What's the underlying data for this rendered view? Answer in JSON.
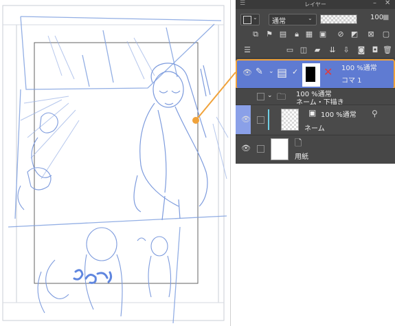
{
  "panel": {
    "title": "レイヤー",
    "blend_mode": "通常",
    "opacity": "100",
    "layers": [
      {
        "opacity_mode": "100 %通常",
        "name": "コマ 1",
        "selected": true
      },
      {
        "opacity_mode": "100 %通常",
        "name": "ネーム・下描き",
        "type": "folder"
      },
      {
        "opacity_mode": "100 %通常",
        "name": "ネーム"
      },
      {
        "name": "用紙"
      }
    ]
  },
  "colors": {
    "panel_bg": "#474747",
    "selected_layer": "#5f7bd2",
    "highlight": "#f0a23a",
    "sketch_blue": "#7fa0e0"
  },
  "icons": [
    "menu-icon",
    "close-icon",
    "minimize-icon",
    "eye-icon",
    "pencil-icon",
    "folder-icon",
    "layer-mask-icon",
    "delete-icon",
    "lock-icon",
    "new-raster-layer-icon",
    "new-folder-icon"
  ]
}
